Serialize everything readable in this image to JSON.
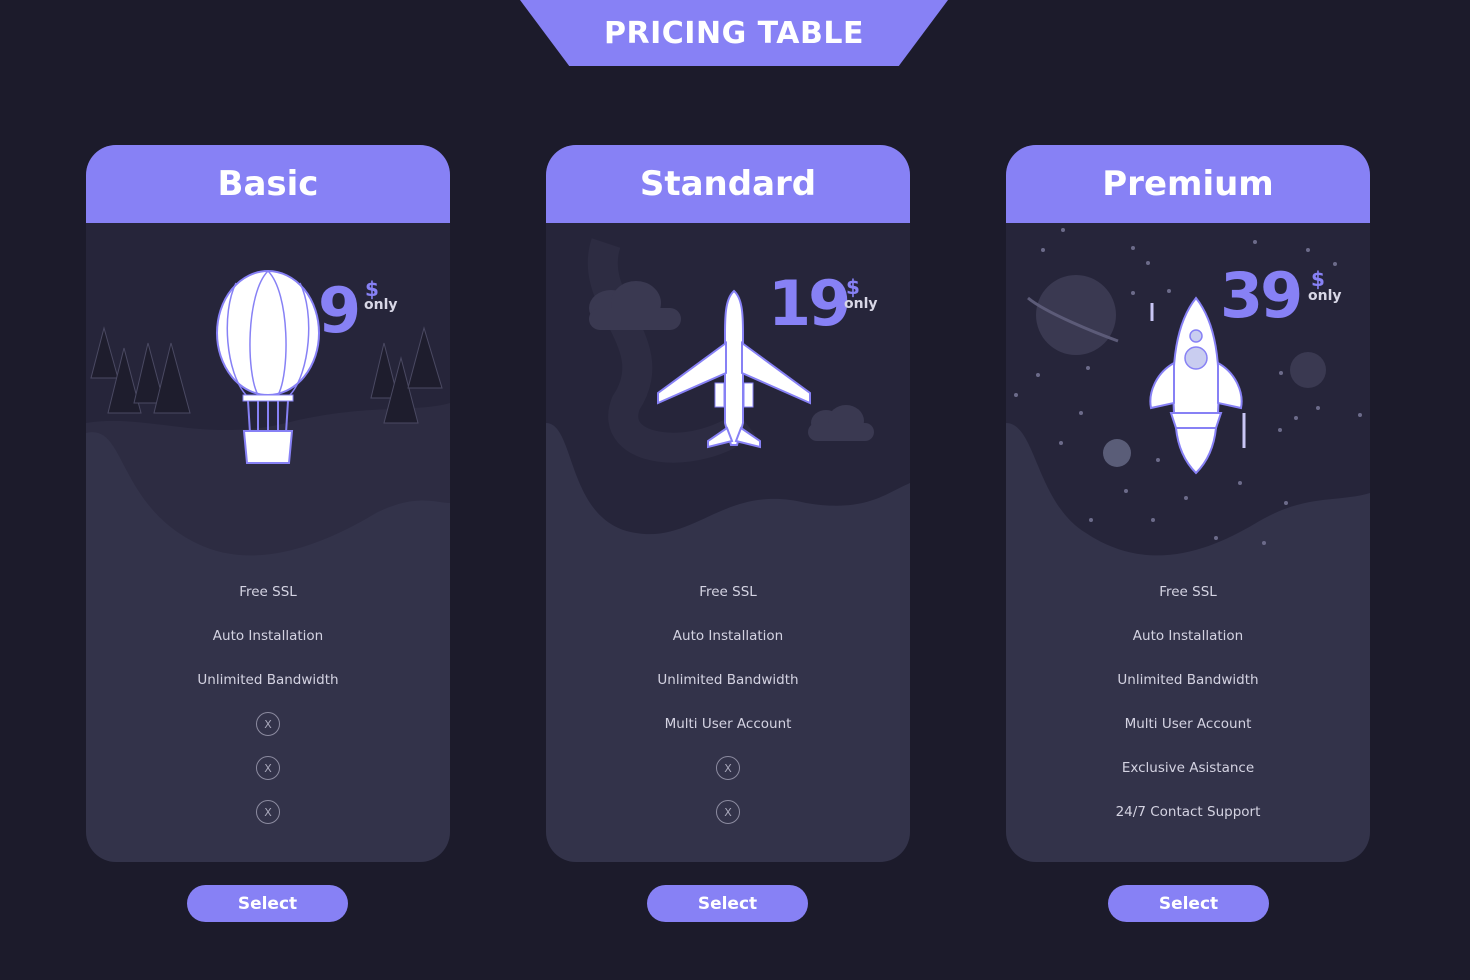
{
  "title": "PRICING TABLE",
  "colors": {
    "background": "#1c1b2b",
    "card": "#33334a",
    "accent": "#8781f5"
  },
  "plans": [
    {
      "name": "Basic",
      "price": "9",
      "currency": "$",
      "price_note": "only",
      "illustration": "hot-air-balloon-icon",
      "features": [
        "Free SSL",
        "Auto Installation",
        "Unlimited Bandwidth",
        null,
        null,
        null
      ],
      "select_label": "Select"
    },
    {
      "name": "Standard",
      "price": "19",
      "currency": "$",
      "price_note": "only",
      "illustration": "airplane-icon",
      "features": [
        "Free SSL",
        "Auto Installation",
        "Unlimited Bandwidth",
        "Multi User Account",
        null,
        null
      ],
      "select_label": "Select"
    },
    {
      "name": "Premium",
      "price": "39",
      "currency": "$",
      "price_note": "only",
      "illustration": "rocket-icon",
      "features": [
        "Free SSL",
        "Auto Installation",
        "Unlimited Bandwidth",
        "Multi User Account",
        "Exclusive Asistance",
        "24/7 Contact Support"
      ],
      "select_label": "Select"
    }
  ],
  "unavailable_mark": "X"
}
